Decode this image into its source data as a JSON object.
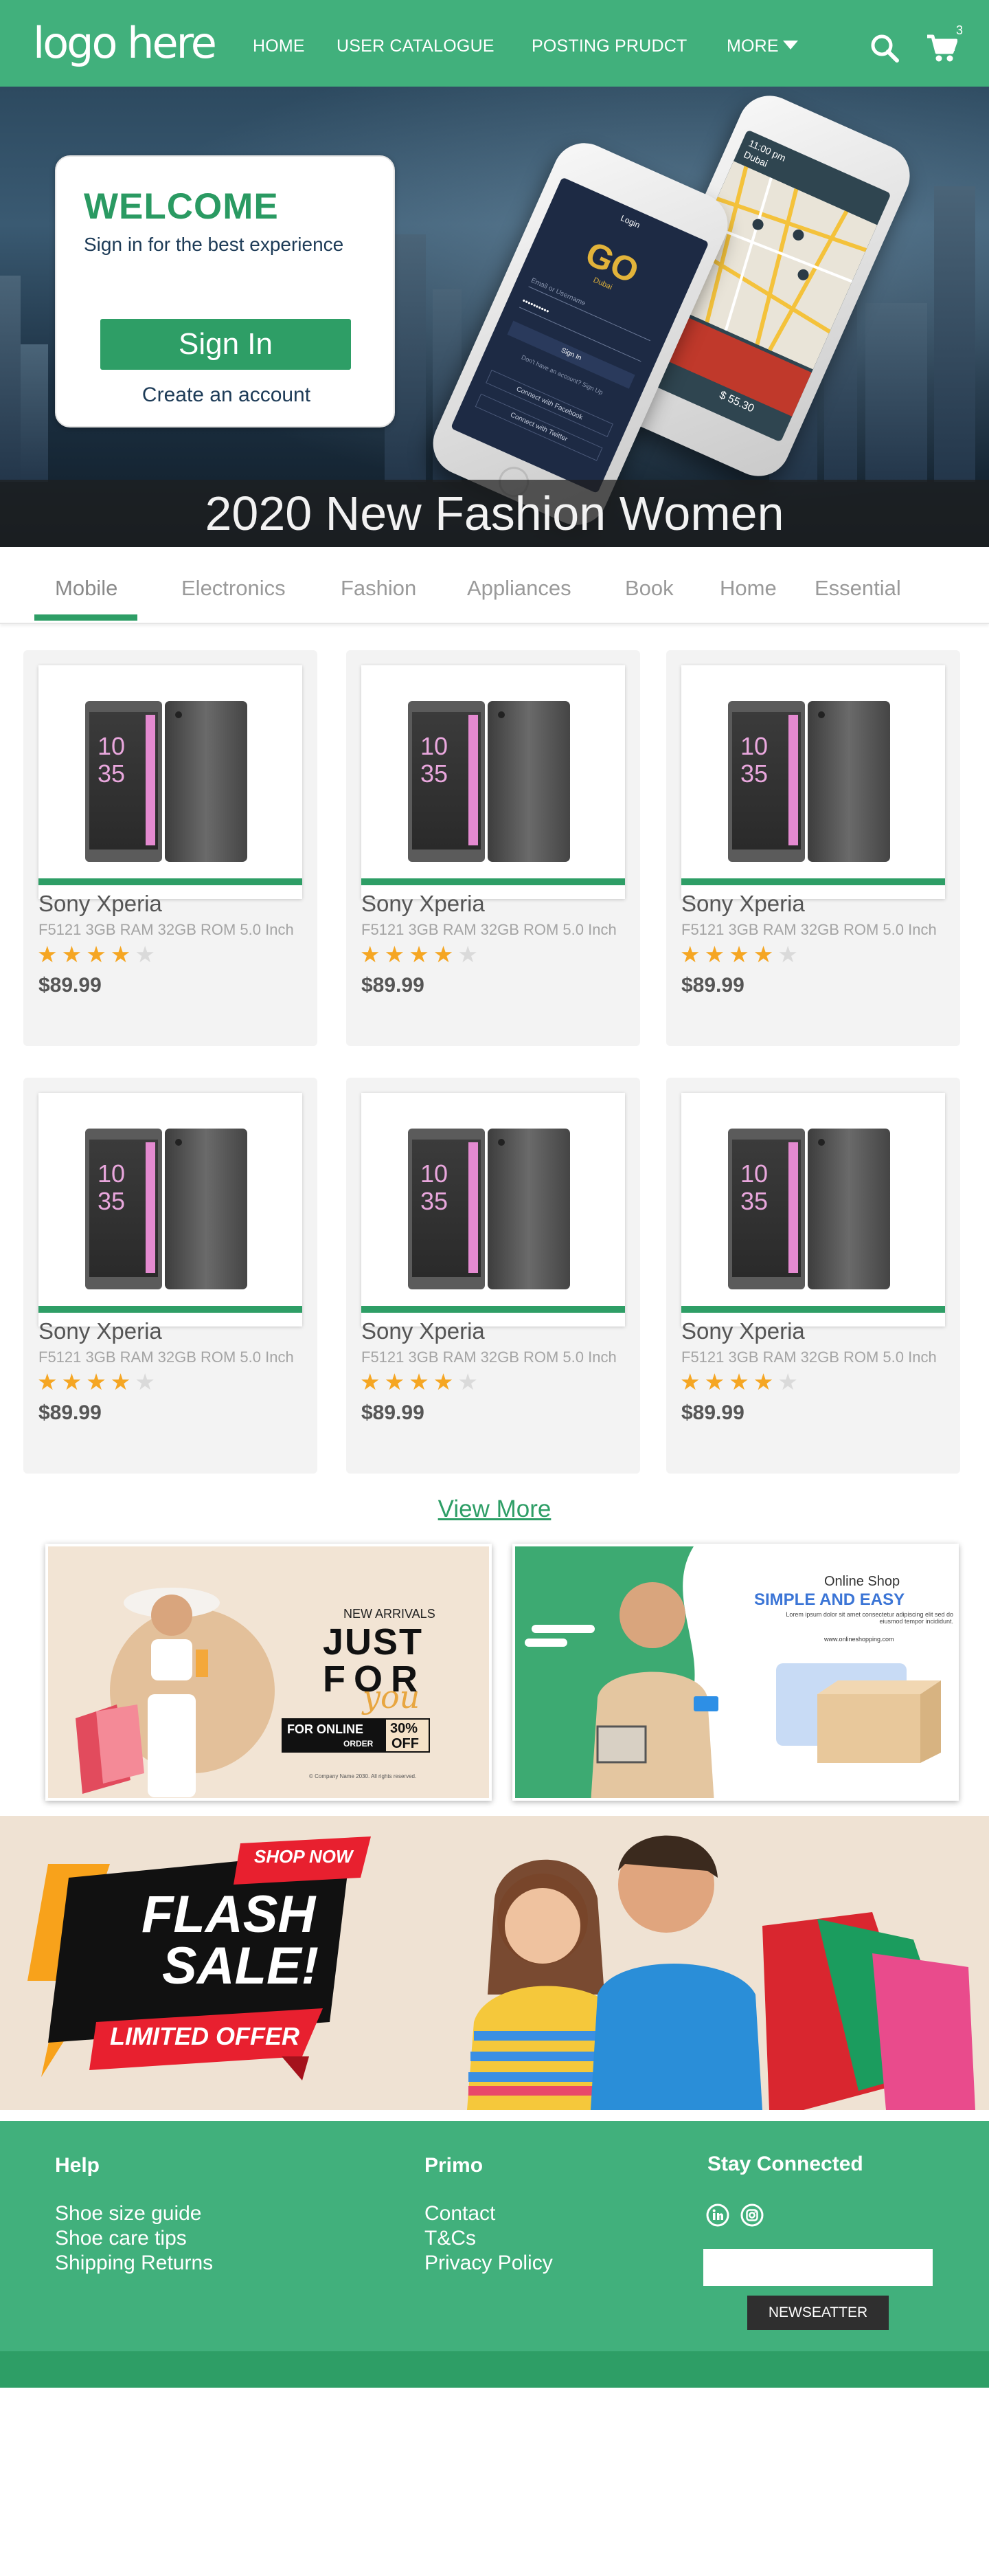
{
  "colors": {
    "brand_green": "#41b07c",
    "accent_green": "#2e9e66",
    "star": "#f5a623"
  },
  "header": {
    "logo": "logo here",
    "nav": [
      "HOME",
      "USER CATALOGUE",
      "POSTING PRUDCT",
      "MORE"
    ],
    "icons": [
      "search-icon",
      "cart-icon"
    ],
    "cart_count": "3"
  },
  "hero": {
    "welcome_title": "WELCOME",
    "welcome_subtitle": "Sign in for the best experience",
    "signin_label": "Sign In",
    "create_account": "Create an account",
    "caption": "2020 New Fashion Women",
    "phone_left": {
      "login_label": "Login",
      "brand": "GO",
      "city": "Dubai",
      "username_placeholder": "Email or Username",
      "password_mask": "••••••••••",
      "signin": "Sign In",
      "no_account": "Don't have an account? Sign Up",
      "facebook": "Connect with Facebook",
      "twitter": "Connect with Twitter"
    },
    "phone_right": {
      "time": "11:00 pm",
      "city": "Dubai",
      "price": "$ 55.30"
    }
  },
  "tabs": {
    "items": [
      "Mobile",
      "Electronics",
      "Fashion",
      "Appliances",
      "Book",
      "Home",
      "Essential"
    ],
    "active": "Mobile"
  },
  "products": [
    {
      "name": "Sony Xperia",
      "desc": "F5121 3GB RAM 32GB ROM 5.0 Inch",
      "rating": 4,
      "price": "$89.99",
      "clock_h": "10",
      "clock_m": "35"
    },
    {
      "name": "Sony Xperia",
      "desc": "F5121 3GB RAM 32GB ROM 5.0 Inch",
      "rating": 4,
      "price": "$89.99",
      "clock_h": "10",
      "clock_m": "35"
    },
    {
      "name": "Sony Xperia",
      "desc": "F5121 3GB RAM 32GB ROM 5.0 Inch",
      "rating": 4,
      "price": "$89.99",
      "clock_h": "10",
      "clock_m": "35"
    },
    {
      "name": "Sony Xperia",
      "desc": "F5121 3GB RAM 32GB ROM 5.0 Inch",
      "rating": 4,
      "price": "$89.99",
      "clock_h": "10",
      "clock_m": "35"
    },
    {
      "name": "Sony Xperia",
      "desc": "F5121 3GB RAM 32GB ROM 5.0 Inch",
      "rating": 4,
      "price": "$89.99",
      "clock_h": "10",
      "clock_m": "35"
    },
    {
      "name": "Sony Xperia",
      "desc": "F5121 3GB RAM 32GB ROM 5.0 Inch",
      "rating": 4,
      "price": "$89.99",
      "clock_h": "10",
      "clock_m": "35"
    }
  ],
  "view_more": "View More",
  "promo_left": {
    "new_arrivals": "NEW ARRIVALS",
    "just": "JUST",
    "for": "FOR",
    "you": "you",
    "online": "FOR ONLINE",
    "order": "ORDER",
    "percent": "30%",
    "off": "OFF",
    "copyright": "© Company Name 2030. All rights reserved."
  },
  "promo_right": {
    "online_shop": "Online Shop",
    "tagline": "SIMPLE AND EASY",
    "body": "Lorem ipsum dolor sit amet consectetur adipiscing elit sed do eiusmod tempor incididunt.",
    "website": "www.onlineshopping.com"
  },
  "flash": {
    "shop_now": "SHOP NOW",
    "flash": "FLASH",
    "sale": "SALE!",
    "limited": "LIMITED OFFER"
  },
  "footer": {
    "help_heading": "Help",
    "help_links": [
      "Shoe size guide",
      "Shoe care tips",
      "Shipping Returns"
    ],
    "primo_heading": "Primo",
    "primo_links": [
      "Contact",
      "T&Cs",
      "Privacy Policy"
    ],
    "stay_heading": "Stay Connected",
    "social_icons": [
      "linkedin-icon",
      "instagram-icon"
    ],
    "newsletter_button": "NEWSEATTER"
  }
}
